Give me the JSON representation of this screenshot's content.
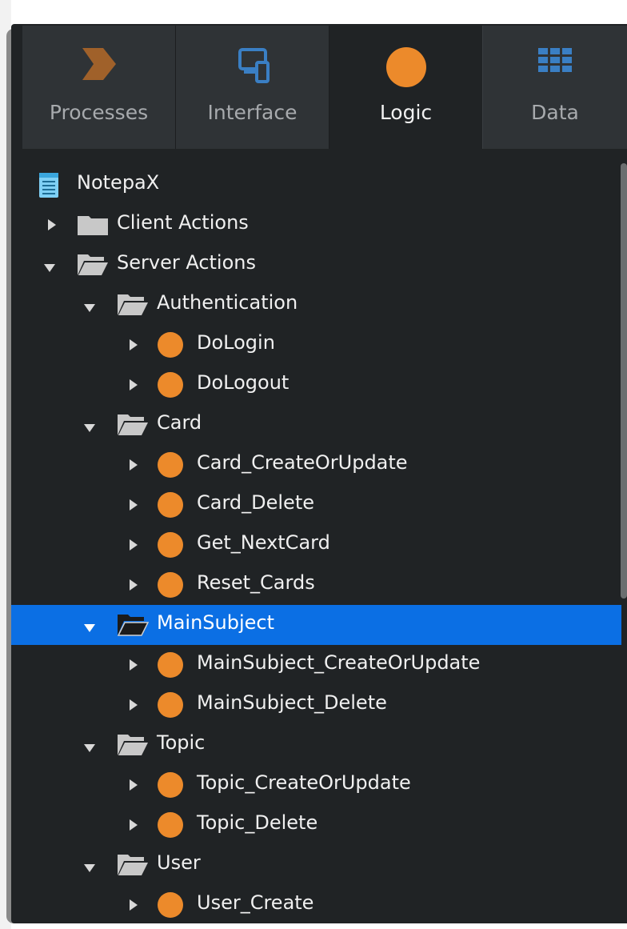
{
  "tabs": [
    {
      "label": "Processes",
      "icon": "processes-chevron-icon"
    },
    {
      "label": "Interface",
      "icon": "interface-devices-icon"
    },
    {
      "label": "Logic",
      "icon": "logic-circle-icon"
    },
    {
      "label": "Data",
      "icon": "data-grid-icon"
    }
  ],
  "active_tab": "Logic",
  "tree": {
    "root": "NotepaX",
    "client_actions": "Client Actions",
    "server_actions": "Server Actions",
    "authentication": "Authentication",
    "do_login": "DoLogin",
    "do_logout": "DoLogout",
    "card": "Card",
    "card_create_or_update": "Card_CreateOrUpdate",
    "card_delete": "Card_Delete",
    "get_next_card": "Get_NextCard",
    "reset_cards": "Reset_Cards",
    "main_subject": "MainSubject",
    "main_subject_create_or_update": "MainSubject_CreateOrUpdate",
    "main_subject_delete": "MainSubject_Delete",
    "topic": "Topic",
    "topic_create_or_update": "Topic_CreateOrUpdate",
    "topic_delete": "Topic_Delete",
    "user": "User",
    "user_create": "User_Create"
  },
  "selected_item": "MainSubject",
  "colors": {
    "panel_bg": "#202325",
    "tab_bg": "#2f3336",
    "accent_orange": "#ec8a2b",
    "processes_brown": "#a0612a",
    "interface_blue": "#3a7fc4",
    "selection_blue": "#0b6fe4",
    "folder_gray": "#c8c8c8",
    "text": "#f0f0f0"
  }
}
